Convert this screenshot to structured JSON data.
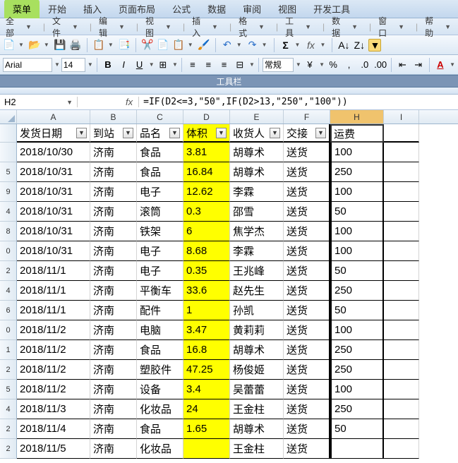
{
  "menu": {
    "items": [
      "菜单",
      "开始",
      "插入",
      "页面布局",
      "公式",
      "数据",
      "审阅",
      "视图",
      "开发工具"
    ],
    "active": 0
  },
  "secbar": {
    "items": [
      "全部",
      "文件",
      "编辑",
      "视图",
      "插入",
      "格式",
      "工具",
      "数据",
      "窗口",
      "帮助"
    ]
  },
  "font": {
    "name": "Arial",
    "size": "14",
    "style": "常规"
  },
  "toolbox_title": "工具栏",
  "cellref": "H2",
  "formula": "=IF(D2<=3,\"50\",IF(D2>13,\"250\",\"100\"))",
  "columns": [
    "A",
    "B",
    "C",
    "D",
    "E",
    "F",
    "H",
    "I"
  ],
  "headers": {
    "A": "发货日期",
    "B": "到站",
    "C": "品名",
    "D": "体积",
    "E": "收货人",
    "F": "交接",
    "H": "运费"
  },
  "rows": [
    {
      "n": "",
      "A": "2018/10/30",
      "B": "济南",
      "C": "食品",
      "D": "3.81",
      "E": "胡尊术",
      "F": "送货",
      "H": "100"
    },
    {
      "n": "5",
      "A": "2018/10/31",
      "B": "济南",
      "C": "食品",
      "D": "16.84",
      "E": "胡尊术",
      "F": "送货",
      "H": "250"
    },
    {
      "n": "9",
      "A": "2018/10/31",
      "B": "济南",
      "C": "电子",
      "D": "12.62",
      "E": "李霖",
      "F": "送货",
      "H": "100"
    },
    {
      "n": "4",
      "A": "2018/10/31",
      "B": "济南",
      "C": "滚筒",
      "D": "0.3",
      "E": "邵雪",
      "F": "送货",
      "H": "50"
    },
    {
      "n": "8",
      "A": "2018/10/31",
      "B": "济南",
      "C": "铁架",
      "D": "6",
      "E": "焦学杰",
      "F": "送货",
      "H": "100"
    },
    {
      "n": "0",
      "A": "2018/10/31",
      "B": "济南",
      "C": "电子",
      "D": "8.68",
      "E": "李霖",
      "F": "送货",
      "H": "100"
    },
    {
      "n": "2",
      "A": "2018/11/1",
      "B": "济南",
      "C": "电子",
      "D": "0.35",
      "E": "王兆峰",
      "F": "送货",
      "H": "50"
    },
    {
      "n": "4",
      "A": "2018/11/1",
      "B": "济南",
      "C": "平衡车",
      "D": "33.6",
      "E": "赵先生",
      "F": "送货",
      "H": "250"
    },
    {
      "n": "6",
      "A": "2018/11/1",
      "B": "济南",
      "C": "配件",
      "D": "1",
      "E": "孙凯",
      "F": "送货",
      "H": "50"
    },
    {
      "n": "0",
      "A": "2018/11/2",
      "B": "济南",
      "C": "电脑",
      "D": "3.47",
      "E": "黄莉莉",
      "F": "送货",
      "H": "100"
    },
    {
      "n": "1",
      "A": "2018/11/2",
      "B": "济南",
      "C": "食品",
      "D": "16.8",
      "E": "胡尊术",
      "F": "送货",
      "H": "250"
    },
    {
      "n": "2",
      "A": "2018/11/2",
      "B": "济南",
      "C": "塑胶件",
      "D": "47.25",
      "E": "杨俊姬",
      "F": "送货",
      "H": "250"
    },
    {
      "n": "5",
      "A": "2018/11/2",
      "B": "济南",
      "C": "设备",
      "D": "3.4",
      "E": "吴蕾蕾",
      "F": "送货",
      "H": "100"
    },
    {
      "n": "4",
      "A": "2018/11/3",
      "B": "济南",
      "C": "化妆品",
      "D": "24",
      "E": "王金柱",
      "F": "送货",
      "H": "250"
    },
    {
      "n": "2",
      "A": "2018/11/4",
      "B": "济南",
      "C": "食品",
      "D": "1.65",
      "E": "胡尊术",
      "F": "送货",
      "H": "50"
    },
    {
      "n": "2",
      "A": "2018/11/5",
      "B": "济南",
      "C": "化妆品",
      "D": "",
      "E": "王金柱",
      "F": "送货",
      "H": ""
    }
  ]
}
